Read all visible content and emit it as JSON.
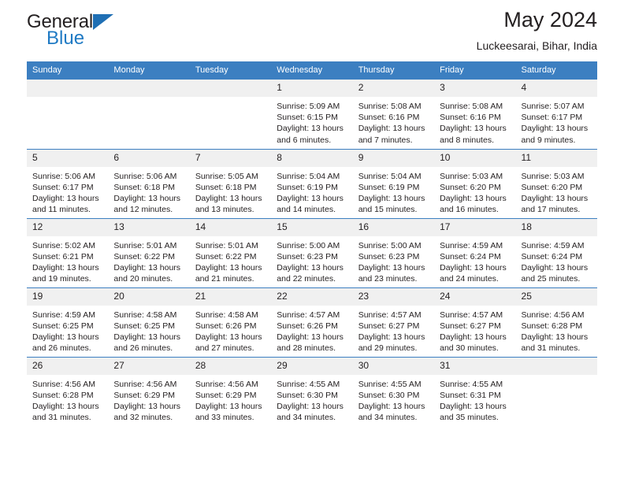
{
  "brand": {
    "name_part1": "General",
    "name_part2": "Blue",
    "triangle_color": "#1f6fb4",
    "blue_color": "#1f7ac4"
  },
  "header": {
    "title": "May 2024",
    "subtitle": "Luckeesarai, Bihar, India"
  },
  "theme": {
    "header_bg": "#3c7fc1",
    "daynum_bg": "#f0f0f0",
    "text": "#231f20"
  },
  "weekdays": [
    "Sunday",
    "Monday",
    "Tuesday",
    "Wednesday",
    "Thursday",
    "Friday",
    "Saturday"
  ],
  "labels": {
    "sunrise": "Sunrise:",
    "sunset": "Sunset:",
    "daylight": "Daylight:"
  },
  "weeks": [
    [
      {
        "day": "",
        "empty": true
      },
      {
        "day": "",
        "empty": true
      },
      {
        "day": "",
        "empty": true
      },
      {
        "day": "1",
        "sunrise": "Sunrise: 5:09 AM",
        "sunset": "Sunset: 6:15 PM",
        "daylight": "Daylight: 13 hours and 6 minutes."
      },
      {
        "day": "2",
        "sunrise": "Sunrise: 5:08 AM",
        "sunset": "Sunset: 6:16 PM",
        "daylight": "Daylight: 13 hours and 7 minutes."
      },
      {
        "day": "3",
        "sunrise": "Sunrise: 5:08 AM",
        "sunset": "Sunset: 6:16 PM",
        "daylight": "Daylight: 13 hours and 8 minutes."
      },
      {
        "day": "4",
        "sunrise": "Sunrise: 5:07 AM",
        "sunset": "Sunset: 6:17 PM",
        "daylight": "Daylight: 13 hours and 9 minutes."
      }
    ],
    [
      {
        "day": "5",
        "sunrise": "Sunrise: 5:06 AM",
        "sunset": "Sunset: 6:17 PM",
        "daylight": "Daylight: 13 hours and 11 minutes."
      },
      {
        "day": "6",
        "sunrise": "Sunrise: 5:06 AM",
        "sunset": "Sunset: 6:18 PM",
        "daylight": "Daylight: 13 hours and 12 minutes."
      },
      {
        "day": "7",
        "sunrise": "Sunrise: 5:05 AM",
        "sunset": "Sunset: 6:18 PM",
        "daylight": "Daylight: 13 hours and 13 minutes."
      },
      {
        "day": "8",
        "sunrise": "Sunrise: 5:04 AM",
        "sunset": "Sunset: 6:19 PM",
        "daylight": "Daylight: 13 hours and 14 minutes."
      },
      {
        "day": "9",
        "sunrise": "Sunrise: 5:04 AM",
        "sunset": "Sunset: 6:19 PM",
        "daylight": "Daylight: 13 hours and 15 minutes."
      },
      {
        "day": "10",
        "sunrise": "Sunrise: 5:03 AM",
        "sunset": "Sunset: 6:20 PM",
        "daylight": "Daylight: 13 hours and 16 minutes."
      },
      {
        "day": "11",
        "sunrise": "Sunrise: 5:03 AM",
        "sunset": "Sunset: 6:20 PM",
        "daylight": "Daylight: 13 hours and 17 minutes."
      }
    ],
    [
      {
        "day": "12",
        "sunrise": "Sunrise: 5:02 AM",
        "sunset": "Sunset: 6:21 PM",
        "daylight": "Daylight: 13 hours and 19 minutes."
      },
      {
        "day": "13",
        "sunrise": "Sunrise: 5:01 AM",
        "sunset": "Sunset: 6:22 PM",
        "daylight": "Daylight: 13 hours and 20 minutes."
      },
      {
        "day": "14",
        "sunrise": "Sunrise: 5:01 AM",
        "sunset": "Sunset: 6:22 PM",
        "daylight": "Daylight: 13 hours and 21 minutes."
      },
      {
        "day": "15",
        "sunrise": "Sunrise: 5:00 AM",
        "sunset": "Sunset: 6:23 PM",
        "daylight": "Daylight: 13 hours and 22 minutes."
      },
      {
        "day": "16",
        "sunrise": "Sunrise: 5:00 AM",
        "sunset": "Sunset: 6:23 PM",
        "daylight": "Daylight: 13 hours and 23 minutes."
      },
      {
        "day": "17",
        "sunrise": "Sunrise: 4:59 AM",
        "sunset": "Sunset: 6:24 PM",
        "daylight": "Daylight: 13 hours and 24 minutes."
      },
      {
        "day": "18",
        "sunrise": "Sunrise: 4:59 AM",
        "sunset": "Sunset: 6:24 PM",
        "daylight": "Daylight: 13 hours and 25 minutes."
      }
    ],
    [
      {
        "day": "19",
        "sunrise": "Sunrise: 4:59 AM",
        "sunset": "Sunset: 6:25 PM",
        "daylight": "Daylight: 13 hours and 26 minutes."
      },
      {
        "day": "20",
        "sunrise": "Sunrise: 4:58 AM",
        "sunset": "Sunset: 6:25 PM",
        "daylight": "Daylight: 13 hours and 26 minutes."
      },
      {
        "day": "21",
        "sunrise": "Sunrise: 4:58 AM",
        "sunset": "Sunset: 6:26 PM",
        "daylight": "Daylight: 13 hours and 27 minutes."
      },
      {
        "day": "22",
        "sunrise": "Sunrise: 4:57 AM",
        "sunset": "Sunset: 6:26 PM",
        "daylight": "Daylight: 13 hours and 28 minutes."
      },
      {
        "day": "23",
        "sunrise": "Sunrise: 4:57 AM",
        "sunset": "Sunset: 6:27 PM",
        "daylight": "Daylight: 13 hours and 29 minutes."
      },
      {
        "day": "24",
        "sunrise": "Sunrise: 4:57 AM",
        "sunset": "Sunset: 6:27 PM",
        "daylight": "Daylight: 13 hours and 30 minutes."
      },
      {
        "day": "25",
        "sunrise": "Sunrise: 4:56 AM",
        "sunset": "Sunset: 6:28 PM",
        "daylight": "Daylight: 13 hours and 31 minutes."
      }
    ],
    [
      {
        "day": "26",
        "sunrise": "Sunrise: 4:56 AM",
        "sunset": "Sunset: 6:28 PM",
        "daylight": "Daylight: 13 hours and 31 minutes."
      },
      {
        "day": "27",
        "sunrise": "Sunrise: 4:56 AM",
        "sunset": "Sunset: 6:29 PM",
        "daylight": "Daylight: 13 hours and 32 minutes."
      },
      {
        "day": "28",
        "sunrise": "Sunrise: 4:56 AM",
        "sunset": "Sunset: 6:29 PM",
        "daylight": "Daylight: 13 hours and 33 minutes."
      },
      {
        "day": "29",
        "sunrise": "Sunrise: 4:55 AM",
        "sunset": "Sunset: 6:30 PM",
        "daylight": "Daylight: 13 hours and 34 minutes."
      },
      {
        "day": "30",
        "sunrise": "Sunrise: 4:55 AM",
        "sunset": "Sunset: 6:30 PM",
        "daylight": "Daylight: 13 hours and 34 minutes."
      },
      {
        "day": "31",
        "sunrise": "Sunrise: 4:55 AM",
        "sunset": "Sunset: 6:31 PM",
        "daylight": "Daylight: 13 hours and 35 minutes."
      },
      {
        "day": "",
        "empty": true
      }
    ]
  ]
}
